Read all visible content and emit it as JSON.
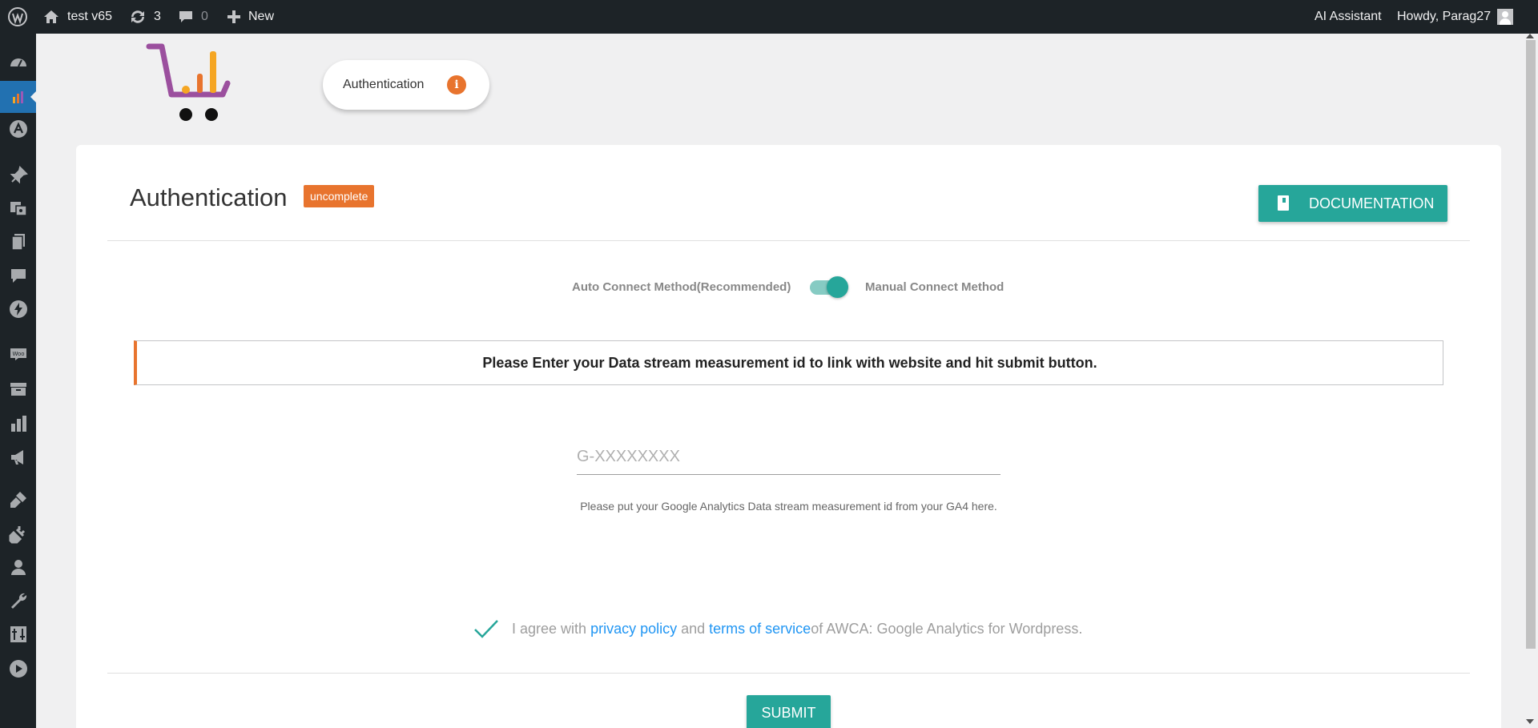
{
  "adminbar": {
    "site_name": "test v65",
    "updates_count": "3",
    "comments_count": "0",
    "new_label": "New",
    "ai_assistant": "AI Assistant",
    "howdy": "Howdy, Parag27"
  },
  "sidebar": {
    "items": [
      {
        "icon": "dashboard-icon"
      },
      {
        "icon": "plugin-chart-icon",
        "active": true
      },
      {
        "icon": "astra-icon"
      },
      {
        "icon": "pin-icon"
      },
      {
        "icon": "media-icon"
      },
      {
        "icon": "pages-icon"
      },
      {
        "icon": "comments-icon"
      },
      {
        "icon": "bolt-icon"
      },
      {
        "icon": "woo-icon"
      },
      {
        "icon": "products-icon"
      },
      {
        "icon": "analytics-icon"
      },
      {
        "icon": "marketing-icon"
      },
      {
        "icon": "appearance-icon"
      },
      {
        "icon": "plugins-icon"
      },
      {
        "icon": "users-icon"
      },
      {
        "icon": "tools-icon"
      },
      {
        "icon": "settings-icon"
      },
      {
        "icon": "play-icon"
      }
    ]
  },
  "header": {
    "tab_label": "Authentication",
    "info_glyph": "i"
  },
  "card": {
    "title": "Authentication",
    "status_badge": "uncomplete",
    "documentation_label": "DOCUMENTATION",
    "toggle": {
      "left_label": "Auto Connect Method(Recommended)",
      "right_label": "Manual Connect Method",
      "state": "manual"
    },
    "notice": "Please Enter your Data stream measurement id to link with website and hit submit button.",
    "input": {
      "placeholder": "G-XXXXXXXX",
      "value": ""
    },
    "helper_text": "Please put your Google Analytics Data stream measurement id from your GA4 here.",
    "agree": {
      "prefix": "I agree with ",
      "privacy_link": "privacy policy",
      "middle": " and ",
      "terms_link": "terms of service",
      "suffix": "of AWCA: Google Analytics for Wordpress.",
      "checked": true
    },
    "submit_label": "SUBMIT"
  },
  "colors": {
    "admin_bar": "#1d2327",
    "accent_teal": "#26a69a",
    "accent_orange": "#e8742e",
    "link_blue": "#2196f3"
  }
}
